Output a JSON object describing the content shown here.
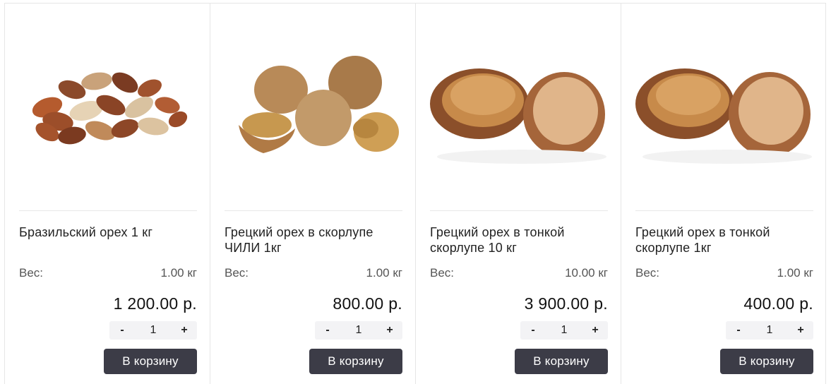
{
  "labels": {
    "weight": "Вес:",
    "cart_button": "В корзину",
    "decrement": "-",
    "increment": "+"
  },
  "products": [
    {
      "title": "Бразильский орех 1 кг",
      "weight": "1.00 кг",
      "price": "1 200.00 р.",
      "quantity": "1",
      "image": "brazil-nuts"
    },
    {
      "title": "Грецкий орех в скорлупе ЧИЛИ 1кг",
      "weight": "1.00 кг",
      "price": "800.00 р.",
      "quantity": "1",
      "image": "walnuts-in-shell"
    },
    {
      "title": "Грецкий орех в тонкой скорлупе 10 кг",
      "weight": "10.00 кг",
      "price": "3 900.00 р.",
      "quantity": "1",
      "image": "walnut-halves"
    },
    {
      "title": "Грецкий орех в тонкой скорлупе 1кг",
      "weight": "1.00 кг",
      "price": "400.00 р.",
      "quantity": "1",
      "image": "walnut-halves"
    }
  ],
  "colors": {
    "button_bg": "#3c3c47",
    "stepper_bg": "#f3f3f5",
    "border": "#e6e6e6"
  }
}
